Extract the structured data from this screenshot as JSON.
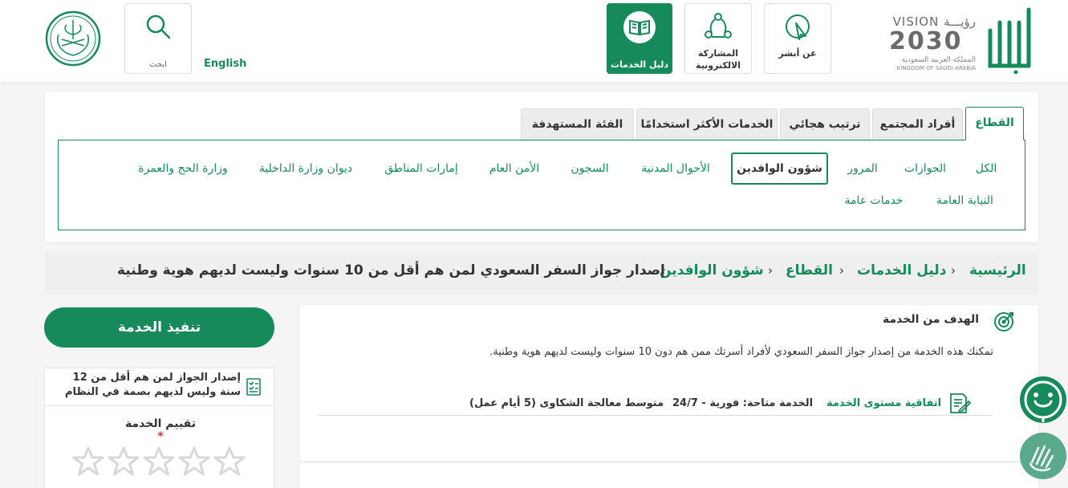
{
  "header": {
    "vision_title": "VISION رؤيـــة",
    "vision_year": "2030",
    "vision_sub_ar": "المملكة العربية السعودية",
    "vision_sub_en": "KINGDOM OF SAUDI ARABIA",
    "nav": {
      "about": "عن أبشر",
      "participation": "المشاركة الالكترونية",
      "guide": "دليل الخدمات",
      "search": "ابحث"
    },
    "language": "English"
  },
  "tabs": [
    {
      "label": "القطاع"
    },
    {
      "label": "أفراد المجتمع"
    },
    {
      "label": "ترتيب هجائي"
    },
    {
      "label": "الخدمات الأكثر استخدامًا"
    },
    {
      "label": "الفئة المستهدفة"
    }
  ],
  "sectors": [
    {
      "label": "الكل"
    },
    {
      "label": "الجوازات"
    },
    {
      "label": "المرور"
    },
    {
      "label": "شؤون الوافدين"
    },
    {
      "label": "الأحوال المدنية"
    },
    {
      "label": "السجون"
    },
    {
      "label": "الأمن العام"
    },
    {
      "label": "إمارات المناطق"
    },
    {
      "label": "ديوان وزارة الداخلية"
    },
    {
      "label": "وزارة الحج والعمرة"
    },
    {
      "label": "النيابة العامة"
    },
    {
      "label": "خدمات عامة"
    }
  ],
  "breadcrumb": [
    {
      "label": "الرئيسية"
    },
    {
      "label": "دليل الخدمات"
    },
    {
      "label": "القطاع"
    },
    {
      "label": "شؤون الوافدين"
    },
    {
      "label": "إصدار جواز السفر السعودي لمن هم أقل من 10 سنوات وليست لديهم هوية وطنية"
    }
  ],
  "service": {
    "goal_title": "الهدف من الخدمة",
    "goal_description": "تمكنك هذه الخدمة من إصدار جواز السفر السعودي لأفراد أسرتك ممن هم دون 10 سنوات وليست لديهم هوية وطنية.",
    "sla_label": "اتفاقية مستوى الخدمة",
    "availability": "الخدمة متاحة: فورية - 24/7",
    "complaints": "متوسط معالجة الشكاوى (5 أيام عمل)"
  },
  "sidebar": {
    "execute_button": "تنفيذ الخدمة",
    "related_service": "إصدار الجواز لمن هم أقل من 12 سنة وليس لديهم بصمة في النظام",
    "rating_label": "تقييم الخدمة",
    "required_mark": "*"
  },
  "colors": {
    "primary": "#178a5c",
    "star": "#d8d8d8",
    "required": "#d63333"
  }
}
